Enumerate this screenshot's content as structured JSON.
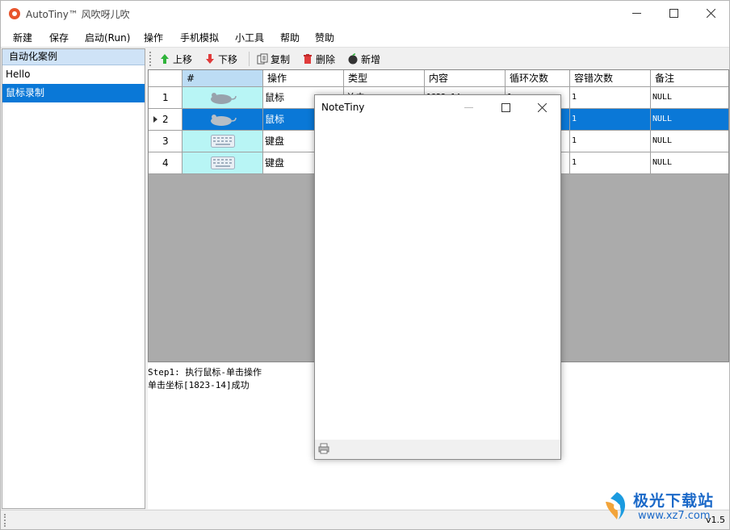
{
  "window": {
    "title": "AutoTiny™ 风吹呀儿吹"
  },
  "menu": [
    {
      "label": "新建"
    },
    {
      "label": "保存"
    },
    {
      "label": "启动(Run)"
    },
    {
      "label": "操作"
    },
    {
      "label": "手机模拟"
    },
    {
      "label": "小工具"
    },
    {
      "label": "帮助"
    },
    {
      "label": "赞助"
    }
  ],
  "sidebar": {
    "header": "自动化案例",
    "items": [
      {
        "label": "Hello",
        "selected": false
      },
      {
        "label": "鼠标录制",
        "selected": true
      }
    ]
  },
  "toolbar": {
    "up": "上移",
    "down": "下移",
    "copy": "复制",
    "delete": "删除",
    "add": "新增"
  },
  "grid": {
    "columns": [
      "#",
      "操作",
      "类型",
      "内容",
      "循环次数",
      "容错次数",
      "备注"
    ],
    "rows": [
      {
        "num": "1",
        "icon": "mouse-icon",
        "op": "鼠标",
        "type": "单击",
        "content": "1823,14",
        "loop": "1",
        "retry": "1",
        "note": "NULL"
      },
      {
        "num": "2",
        "icon": "mouse-icon",
        "op": "鼠标",
        "type": "",
        "content": "",
        "loop": "",
        "retry": "1",
        "note": "NULL"
      },
      {
        "num": "3",
        "icon": "keyboard-icon",
        "op": "键盘",
        "type": "",
        "content": "",
        "loop": "",
        "retry": "1",
        "note": "NULL"
      },
      {
        "num": "4",
        "icon": "keyboard-icon",
        "op": "键盘",
        "type": "",
        "content": "",
        "loop": "",
        "retry": "1",
        "note": "NULL"
      }
    ],
    "selected_row": 2
  },
  "log": {
    "lines": [
      "Step1: 执行鼠标-单击操作",
      "单击坐标[1823-14]成功"
    ]
  },
  "status": {
    "version": "v1.5"
  },
  "popup": {
    "title": "NoteTiny"
  },
  "watermark": {
    "name": "极光下载站",
    "url": "www.xz7.com"
  },
  "colors": {
    "selection": "#0a78d7",
    "icon_cell": "#b8f5f5",
    "header_selected": "#bcdcf4"
  }
}
